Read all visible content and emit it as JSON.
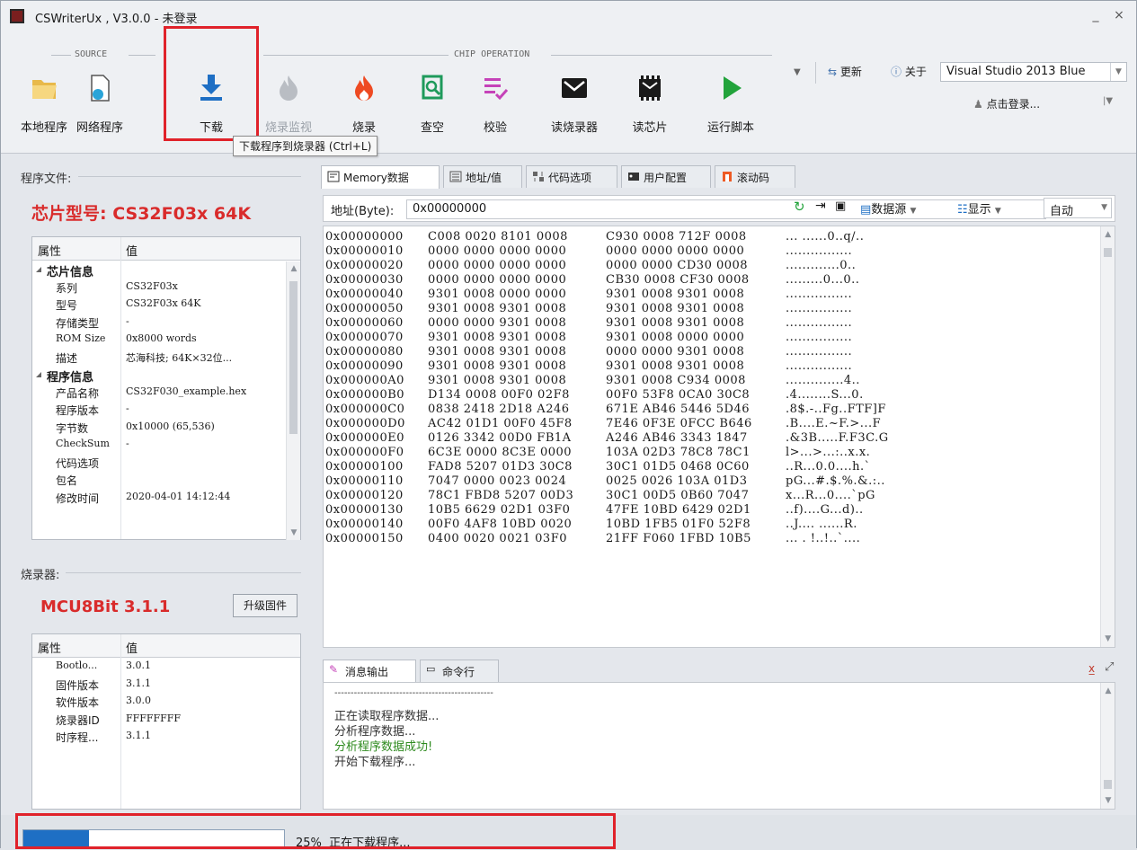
{
  "window": {
    "title": "CSWriterUx , V3.0.0 - 未登录",
    "minimize": "_",
    "close": "×"
  },
  "ribbon": {
    "groups": {
      "source": "SOURCE",
      "chip_operation": "CHIP OPERATION"
    },
    "buttons": {
      "local_program": "本地程序",
      "network_program": "网络程序",
      "download": "下载",
      "burn_monitor": "烧录监视",
      "burn": "烧录",
      "blank_check": "查空",
      "verify": "校验",
      "read_burner": "读烧录器",
      "read_chip": "读芯片",
      "run_script": "运行脚本"
    },
    "tooltip": "下载程序到烧录器 (Ctrl+L)",
    "update": "更新",
    "about": "关于",
    "theme": "Visual Studio 2013 Blue",
    "login": "点击登录..."
  },
  "program_file": {
    "section_label": "程序文件:",
    "chip_model": "芯片型号: CS32F03x 64K",
    "col_property": "属性",
    "col_value": "值",
    "rows": [
      {
        "k": "芯片信息",
        "v": "",
        "cat": true
      },
      {
        "k": "系列",
        "v": "CS32F03x"
      },
      {
        "k": "型号",
        "v": "CS32F03x 64K"
      },
      {
        "k": "存储类型",
        "v": "-"
      },
      {
        "k": "ROM Size",
        "v": "0x8000 words"
      },
      {
        "k": "描述",
        "v": "芯海科技; 64K×32位..."
      },
      {
        "k": "程序信息",
        "v": "",
        "cat": true
      },
      {
        "k": "产品名称",
        "v": "CS32F030_example.hex"
      },
      {
        "k": "程序版本",
        "v": "-"
      },
      {
        "k": "字节数",
        "v": "0x10000 (65,536)"
      },
      {
        "k": "CheckSum",
        "v": "-"
      },
      {
        "k": "代码选项",
        "v": ""
      },
      {
        "k": "包名",
        "v": ""
      },
      {
        "k": "修改时间",
        "v": "2020-04-01 14:12:44"
      }
    ]
  },
  "burner": {
    "section_label": "烧录器:",
    "model": "MCU8Bit 3.1.1",
    "upgrade_button": "升级固件",
    "col_property": "属性",
    "col_value": "值",
    "rows": [
      {
        "k": "Bootlo...",
        "v": "3.0.1"
      },
      {
        "k": "固件版本",
        "v": "3.1.1"
      },
      {
        "k": "软件版本",
        "v": "3.0.0"
      },
      {
        "k": "烧录器ID",
        "v": "FFFFFFFF"
      },
      {
        "k": "时序程...",
        "v": "3.1.1"
      }
    ]
  },
  "tabs": [
    "Memory数据",
    "地址/值",
    "代码选项",
    "用户配置",
    "滚动码"
  ],
  "memory_toolbar": {
    "addr_label": "地址(Byte):",
    "addr_value": "0x00000000",
    "b": "B",
    "w": "W",
    "data_source": "数据源",
    "display": "显示",
    "auto": "自动"
  },
  "memory_rows": [
    {
      "a": "0x00000000",
      "d1": "C008 0020 8101 0008",
      "d2": "C930 0008 712F 0008",
      "s": "... ......0..q/.."
    },
    {
      "a": "0x00000010",
      "d1": "0000 0000 0000 0000",
      "d2": "0000 0000 0000 0000",
      "s": "................"
    },
    {
      "a": "0x00000020",
      "d1": "0000 0000 0000 0000",
      "d2": "0000 0000 CD30 0008",
      "s": ".............0.."
    },
    {
      "a": "0x00000030",
      "d1": "0000 0000 0000 0000",
      "d2": "CB30 0008 CF30 0008",
      "s": ".........0...0.."
    },
    {
      "a": "0x00000040",
      "d1": "9301 0008 0000 0000",
      "d2": "9301 0008 9301 0008",
      "s": "................"
    },
    {
      "a": "0x00000050",
      "d1": "9301 0008 9301 0008",
      "d2": "9301 0008 9301 0008",
      "s": "................"
    },
    {
      "a": "0x00000060",
      "d1": "0000 0000 9301 0008",
      "d2": "9301 0008 9301 0008",
      "s": "................"
    },
    {
      "a": "0x00000070",
      "d1": "9301 0008 9301 0008",
      "d2": "9301 0008 0000 0000",
      "s": "................"
    },
    {
      "a": "0x00000080",
      "d1": "9301 0008 9301 0008",
      "d2": "0000 0000 9301 0008",
      "s": "................"
    },
    {
      "a": "0x00000090",
      "d1": "9301 0008 9301 0008",
      "d2": "9301 0008 9301 0008",
      "s": "................"
    },
    {
      "a": "0x000000A0",
      "d1": "9301 0008 9301 0008",
      "d2": "9301 0008 C934 0008",
      "s": "..............4.."
    },
    {
      "a": "0x000000B0",
      "d1": "D134 0008 00F0 02F8",
      "d2": "00F0 53F8 0CA0 30C8",
      "s": ".4........S...0."
    },
    {
      "a": "0x000000C0",
      "d1": "0838 2418 2D18 A246",
      "d2": "671E AB46 5446 5D46",
      "s": ".8$.-..Fg..FTF]F"
    },
    {
      "a": "0x000000D0",
      "d1": "AC42 01D1 00F0 45F8",
      "d2": "7E46 0F3E 0FCC B646",
      "s": ".B....E.~F.>...F"
    },
    {
      "a": "0x000000E0",
      "d1": "0126 3342 00D0 FB1A",
      "d2": "A246 AB46 3343 1847",
      "s": ".&3B.....F.F3C.G"
    },
    {
      "a": "0x000000F0",
      "d1": "6C3E 0000 8C3E 0000",
      "d2": "103A 02D3 78C8 78C1",
      "s": "l>...>...:..x.x."
    },
    {
      "a": "0x00000100",
      "d1": "FAD8 5207 01D3 30C8",
      "d2": "30C1 01D5 0468 0C60",
      "s": "..R...0.0....h.`"
    },
    {
      "a": "0x00000110",
      "d1": "7047 0000 0023 0024",
      "d2": "0025 0026 103A 01D3",
      "s": "pG...#.$.%.&.:.."
    },
    {
      "a": "0x00000120",
      "d1": "78C1 FBD8 5207 00D3",
      "d2": "30C1 00D5 0B60 7047",
      "s": "x...R...0....`pG"
    },
    {
      "a": "0x00000130",
      "d1": "10B5 6629 02D1 03F0",
      "d2": "47FE 10BD 6429 02D1",
      "s": "..f)....G...d).."
    },
    {
      "a": "0x00000140",
      "d1": "00F0 4AF8 10BD 0020",
      "d2": "10BD 1FB5 01F0 52F8",
      "s": "..J.... ......R."
    },
    {
      "a": "0x00000150",
      "d1": "0400 0020 0021 03F0",
      "d2": "21FF F060 1FBD 10B5",
      "s": "... . !..!..`...."
    }
  ],
  "message_tabs": [
    "消息输出",
    "命令行"
  ],
  "messages": [
    {
      "text": "-------------------------------------------------",
      "color": "#333333"
    },
    {
      "text": "正在读取程序数据...",
      "color": "#333333"
    },
    {
      "text": "分析程序数据...",
      "color": "#333333"
    },
    {
      "text": "分析程序数据成功!",
      "color": "#2e8b1f"
    },
    {
      "text": "开始下载程序...",
      "color": "#333333"
    }
  ],
  "status": {
    "progress": 0.25,
    "percent_text": "25%",
    "text": "正在下载程序..."
  },
  "colors": {
    "accent": "#1e6fc4",
    "highlight": "#e0222a",
    "chip_title": "#d92b2b"
  }
}
